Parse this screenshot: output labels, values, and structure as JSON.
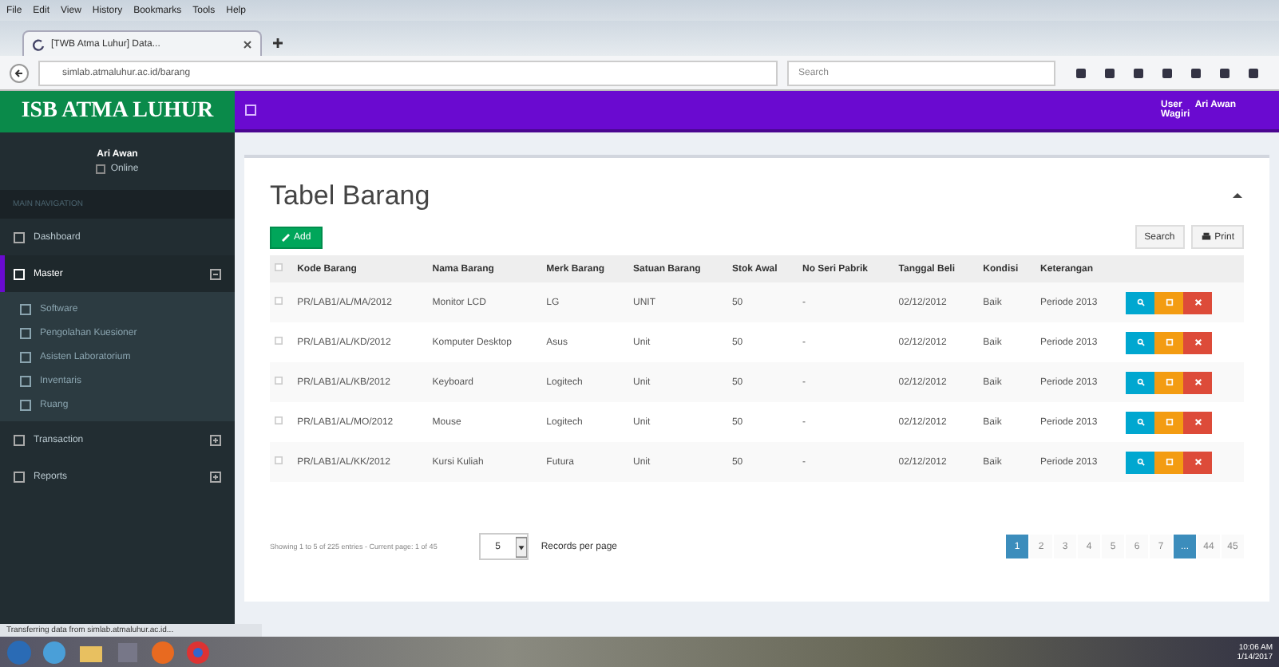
{
  "browser": {
    "menu": [
      "File",
      "Edit",
      "View",
      "History",
      "Bookmarks",
      "Tools",
      "Help"
    ],
    "tab_title": "[TWB Atma Luhur] Data...",
    "address": "simlab.atmaluhur.ac.id/barang",
    "search_placeholder": "Search"
  },
  "header": {
    "brand": "ISB ATMA LUHUR",
    "user": [
      "User",
      "Ari Awan",
      "Wagiri"
    ]
  },
  "sidebar": {
    "user_name": "Ari Awan",
    "status": "Online",
    "section_label": "MAIN NAVIGATION",
    "items": [
      {
        "label": "Dashboard",
        "selected": false
      },
      {
        "label": "Master",
        "selected": true,
        "expanded": true,
        "children": [
          {
            "label": "Software"
          },
          {
            "label": "Pengolahan Kuesioner"
          },
          {
            "label": "Asisten Laboratorium"
          },
          {
            "label": "Inventaris"
          },
          {
            "label": "Ruang"
          }
        ]
      },
      {
        "label": "Transaction",
        "selected": false,
        "expanded": false
      },
      {
        "label": "Reports",
        "selected": false,
        "expanded": false
      }
    ]
  },
  "panel": {
    "title": "Tabel Barang",
    "add_label": "Add",
    "search_label": "Search",
    "print_label": "Print",
    "table": {
      "all_checked": false,
      "columns": [
        "Kode Barang",
        "Nama Barang",
        "Merk Barang",
        "Satuan Barang",
        "Stok Awal",
        "No Seri Pabrik",
        "Tanggal Beli",
        "Kondisi",
        "Keterangan"
      ],
      "rows": [
        {
          "checked": false,
          "cells": [
            "PR/LAB1/AL/MA/2012",
            "Monitor LCD",
            "LG",
            "UNIT",
            "50",
            "-",
            "02/12/2012",
            "Baik",
            "Periode 2013"
          ]
        },
        {
          "checked": false,
          "cells": [
            "PR/LAB1/AL/KD/2012",
            "Komputer Desktop",
            "Asus",
            "Unit",
            "50",
            "-",
            "02/12/2012",
            "Baik",
            "Periode 2013"
          ]
        },
        {
          "checked": false,
          "cells": [
            "PR/LAB1/AL/KB/2012",
            "Keyboard",
            "Logitech",
            "Unit",
            "50",
            "-",
            "02/12/2012",
            "Baik",
            "Periode 2013"
          ]
        },
        {
          "checked": false,
          "cells": [
            "PR/LAB1/AL/MO/2012",
            "Mouse",
            "Logitech",
            "Unit",
            "50",
            "-",
            "02/12/2012",
            "Baik",
            "Periode 2013"
          ]
        },
        {
          "checked": false,
          "cells": [
            "PR/LAB1/AL/KK/2012",
            "Kursi Kuliah",
            "Futura",
            "Unit",
            "50",
            "-",
            "02/12/2012",
            "Baik",
            "Periode 2013"
          ]
        }
      ]
    },
    "footer": {
      "info": "Showing 1 to 5 of 225 entries - Current page: 1 of 45",
      "per_page": "5",
      "per_page_label": "Records per page",
      "pages": [
        {
          "label": "1",
          "selected": true
        },
        {
          "label": "2",
          "selected": false
        },
        {
          "label": "3",
          "selected": false
        },
        {
          "label": "4",
          "selected": false
        },
        {
          "label": "5",
          "selected": false
        },
        {
          "label": "6",
          "selected": false
        },
        {
          "label": "7",
          "selected": false
        },
        {
          "label": "...",
          "selected": true
        },
        {
          "label": "44",
          "selected": false
        },
        {
          "label": "45",
          "selected": false
        }
      ]
    }
  },
  "status_text": "Transferring data from simlab.atmaluhur.ac.id...",
  "taskbar": {
    "time": "10:06 AM",
    "date": "1/14/2017"
  }
}
